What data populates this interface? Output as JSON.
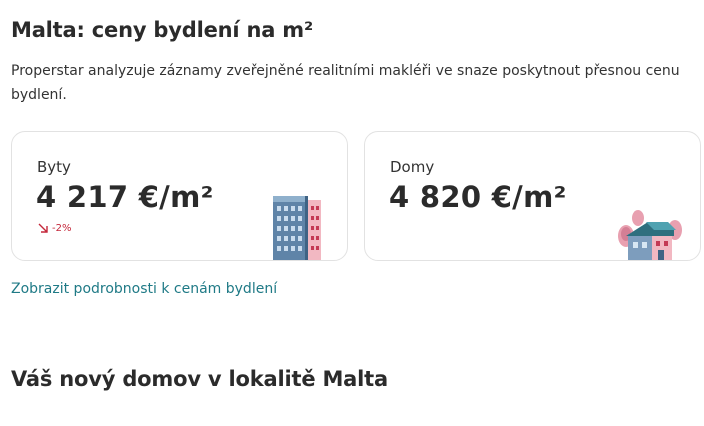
{
  "header": {
    "title": "Malta: ceny bydlení na m²",
    "description": "Properstar analyzuje záznamy zveřejněné realitními makléři ve snaze poskytnout přesnou cenu bydlení."
  },
  "cards": {
    "flats": {
      "label": "Byty",
      "price": "4 217 €/m²",
      "trend": "-2%",
      "trend_direction": "down",
      "trend_color": "#c4273a",
      "illustration": "apartment-building-icon"
    },
    "houses": {
      "label": "Domy",
      "price": "4 820 €/m²",
      "illustration": "house-icon"
    }
  },
  "details_link": "Zobrazit podrobnosti k cenám bydlení",
  "section": {
    "title": "Váš nový domov v lokalitě Malta"
  },
  "colors": {
    "link": "#1f7a86",
    "text": "#2b2b2b",
    "card_border": "#e2e2e2"
  }
}
